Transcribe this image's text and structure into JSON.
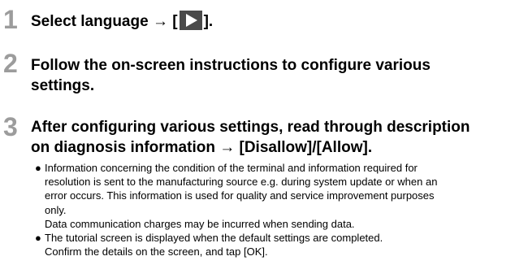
{
  "steps": [
    {
      "number": "1",
      "text_before": "Select language",
      "arrow": "→",
      "bracket_open": "[",
      "icon": "play-icon",
      "bracket_close": "]."
    },
    {
      "number": "2",
      "lines": [
        "Follow the on-screen instructions to configure various",
        "settings."
      ]
    },
    {
      "number": "3",
      "lines": [
        "After configuring various settings, read through description",
        "on diagnosis information → [Disallow]/[Allow]."
      ]
    }
  ],
  "notes": [
    {
      "bullet": "●",
      "lines": [
        "Information concerning the condition of the terminal and information required for",
        "resolution is sent to the manufacturing source e.g. during system update or when an",
        "error occurs. This information is used for quality and service improvement purposes",
        "only.",
        "Data communication charges may be incurred when sending data."
      ]
    },
    {
      "bullet": "●",
      "lines": [
        "The tutorial screen is displayed when the default settings are completed.",
        "Confirm the details on the screen, and tap [OK]."
      ]
    }
  ],
  "colors": {
    "step_number": "#9c9c9c",
    "icon_bg": "#4a4a4a",
    "text": "#000000"
  }
}
